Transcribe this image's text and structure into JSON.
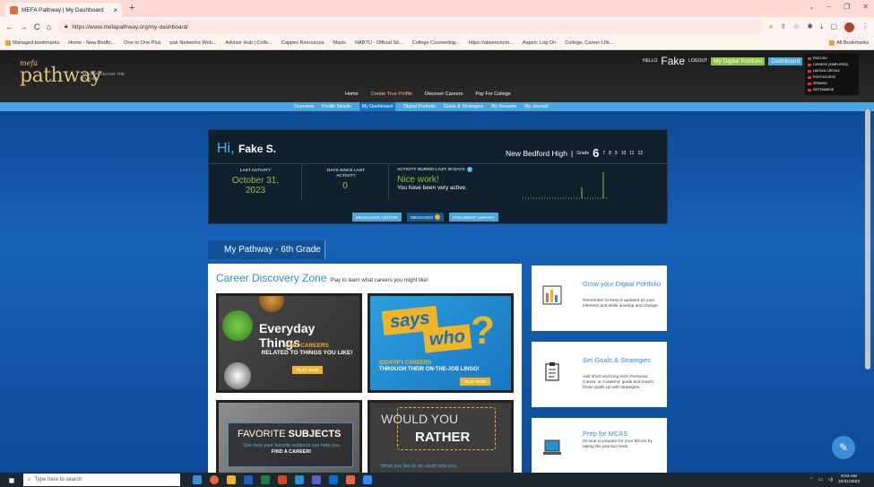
{
  "browser": {
    "tab_title": "MEFA Pathway | My Dashboard",
    "url": "https://www.mefapathway.org/my-dashboard/",
    "bookmarks": [
      "Managed bookmarks",
      "Home - New Bedfo...",
      "One to One Plus",
      "pair Networks Web...",
      "Advisor Hub | Colle...",
      "Cappex Resources",
      "Mavis",
      "NABTU - Official Sit...",
      "College Counseling...",
      "https://absencesm...",
      "Aspen: Log On",
      "College, Career Life..."
    ],
    "all_bookmarks": "All Bookmarks"
  },
  "site": {
    "logo_meta": "mefa",
    "logo_pathway": "pathway",
    "logo_tagline": "YOUR PLAN FOR THE FUTURE",
    "hello": "HELLO",
    "user_first": "Fake",
    "logout": "LOGOUT",
    "digital_portfolio_btn": "My Digital Portfolio",
    "dashboard_btn": "Dashboard",
    "languages": [
      "ENGLISH",
      "CHINESE (SIMPLIFIED)",
      "HAITIAN CREOLE",
      "PORTUGUESE",
      "SPANISH",
      "VIETNAMESE"
    ],
    "main_nav": [
      "Home",
      "Create Your Profile",
      "Discover Careers",
      "Pay For College"
    ],
    "sub_nav": [
      "Overview",
      "Profile Details",
      "My Dashboard",
      "Digital Portfolio",
      "Goals & Strategies",
      "My Resume",
      "My Journal"
    ]
  },
  "dashboard": {
    "hi": "Hi,",
    "name": "Fake S.",
    "school": "New Bedford High",
    "grade_label": "Grade",
    "current_grade": "6",
    "other_grades": [
      "7",
      "8",
      "9",
      "10",
      "11",
      "12"
    ],
    "last_activity_label": "LAST ACTIVITY",
    "last_activity_value": "October 31, 2023",
    "days_since_label": "DAYS SINCE LAST ACTIVITY",
    "days_since_value": "0",
    "activity_label": "ACTIVITY DURING LAST 30 DAYS",
    "activity_headline": "Nice work!",
    "activity_text": "You have been very active.",
    "btn_messaging": "MESSAGING CENTER",
    "btn_messages": "MESSAGES",
    "btn_library": "DOCUMENT LIBRARY"
  },
  "pathway_title": "My Pathway - 6th Grade",
  "career_zone": {
    "title": "Career Discovery Zone",
    "subtitle": "Play to learn what careers you might like!",
    "everyday_title": "Everyday Things",
    "everyday_find": "FIND CAREERS",
    "everyday_related": "RELATED TO THINGS YOU LIKE!",
    "play_now": "PLAY NOW",
    "says": "says",
    "who": "who",
    "identify": "IDENTIFY CAREERS",
    "through": "THROUGH THEIR ON-THE-JOB LINGO!",
    "fav_title_a": "FAVORITE",
    "fav_title_b": "SUBJECTS",
    "fav_sub_a": "See how your favorite subjects",
    "fav_sub_b": "can help you",
    "fav_sub_c": "FIND A CAREER!",
    "wyr_1": "WOULD YOU",
    "wyr_2": "RATHER",
    "wyr_3": "What you like to do could help you"
  },
  "cards": [
    {
      "title": "Grow your Digital Portfolio",
      "desc": "Remember to keep it updated as your interests and skills develop and change."
    },
    {
      "title": "Set Goals & Strategies",
      "desc": "Add short and long-term Personal, Career, & Academic goals and match those goals up with strategies."
    },
    {
      "title": "Prep for MCAS",
      "desc": "Its time to prepare for your MCAS by taking the practice tests."
    }
  ],
  "taskbar": {
    "search_placeholder": "Type here to search",
    "time": "8:53 AM",
    "date": "10/31/2023"
  },
  "colors": {
    "accent_blue": "#2a8fd0",
    "green": "#8cc63e",
    "gold": "#f0b429"
  }
}
